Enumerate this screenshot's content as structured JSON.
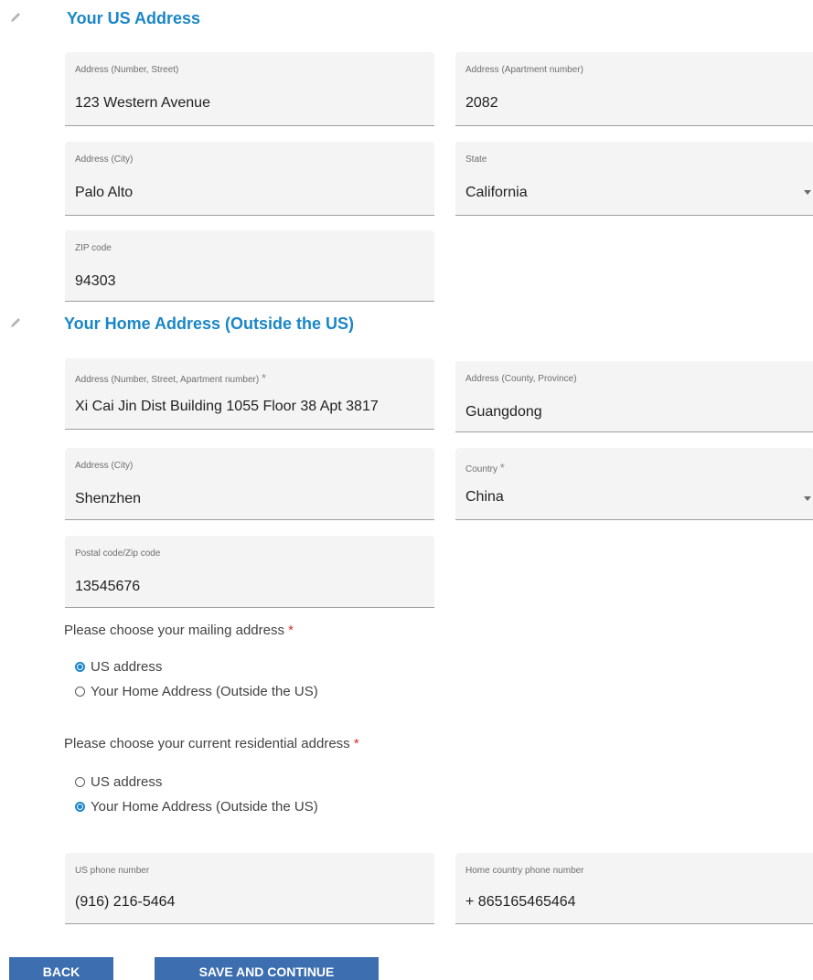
{
  "us_address": {
    "title": "Your US Address",
    "street": {
      "label": "Address (Number, Street)",
      "value": "123 Western Avenue"
    },
    "apartment": {
      "label": "Address (Apartment number)",
      "value": "2082"
    },
    "city": {
      "label": "Address (City)",
      "value": "Palo Alto"
    },
    "state": {
      "label": "State",
      "value": "California"
    },
    "zip": {
      "label": "ZIP code",
      "value": "94303"
    }
  },
  "home_address": {
    "title": "Your Home Address (Outside the US)",
    "street": {
      "label": "Address (Number, Street, Apartment number)",
      "required_mark": "*",
      "value": "Xi Cai Jin Dist Building 1055 Floor 38 Apt 3817"
    },
    "county": {
      "label": "Address (County, Province)",
      "value": "Guangdong"
    },
    "city": {
      "label": "Address (City)",
      "value": "Shenzhen"
    },
    "country": {
      "label": "Country",
      "required_mark": "*",
      "value": "China"
    },
    "postal": {
      "label": "Postal code/Zip code",
      "value": "13545676"
    }
  },
  "mailing": {
    "question": "Please choose your mailing address",
    "required_mark": "*",
    "options": [
      {
        "label": "US address",
        "checked": true
      },
      {
        "label": "Your Home Address (Outside the US)",
        "checked": false
      }
    ]
  },
  "residential": {
    "question": "Please choose your current residential address",
    "required_mark": "*",
    "options": [
      {
        "label": "US address",
        "checked": false
      },
      {
        "label": "Your Home Address (Outside the US)",
        "checked": true
      }
    ]
  },
  "phones": {
    "us": {
      "label": "US phone number",
      "value": "(916) 216-5464"
    },
    "home": {
      "label": "Home country phone number",
      "value": "+ 865165465464"
    }
  },
  "buttons": {
    "back": "BACK",
    "save": "SAVE AND CONTINUE"
  },
  "colors": {
    "accent": "#1a86c7",
    "button": "#3d6fb0",
    "required": "#d32f2f"
  },
  "icons": {
    "edit": "pencil-icon",
    "dropdown": "caret-down-icon"
  }
}
